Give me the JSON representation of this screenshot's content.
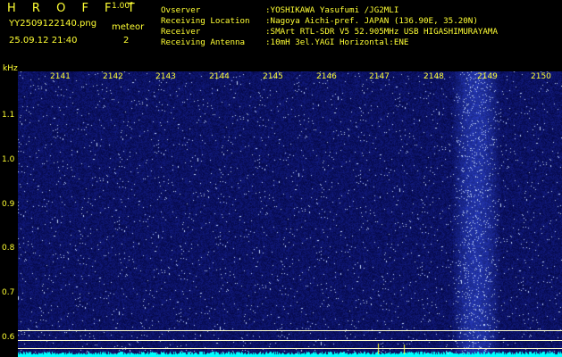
{
  "header": {
    "logo": "H R O F F T",
    "version": "1.00f",
    "filename": "YY2509122140.png",
    "datetime": "25.09.12 21:40",
    "meteor_label": "meteor",
    "meteor_count": "2"
  },
  "info": [
    {
      "label": "Ovserver",
      "value": ":YOSHIKAWA Yasufumi /JG2MLI"
    },
    {
      "label": "Receiving Location",
      "value": ":Nagoya Aichi-pref. JAPAN (136.90E, 35.20N)"
    },
    {
      "label": "Receiver",
      "value": ":SMArt RTL-SDR V5 52.905MHz USB HIGASHIMURAYAMA"
    },
    {
      "label": "Receiving Antenna",
      "value": ":10mH 3el.YAGI Horizontal:ENE"
    }
  ],
  "axis": {
    "y_unit": "kHz",
    "x_ticks": [
      "2141",
      "2142",
      "2143",
      "2144",
      "2145",
      "2146",
      "2147",
      "2148",
      "2149",
      "2150"
    ],
    "y_ticks": [
      "1.1",
      "1.0",
      "0.9",
      "0.8",
      "0.7",
      "0.6"
    ]
  },
  "colors": {
    "text": "#ffff33",
    "background": "#040860",
    "noise_bright": "#8090ff",
    "baseline": "#00ffff"
  }
}
